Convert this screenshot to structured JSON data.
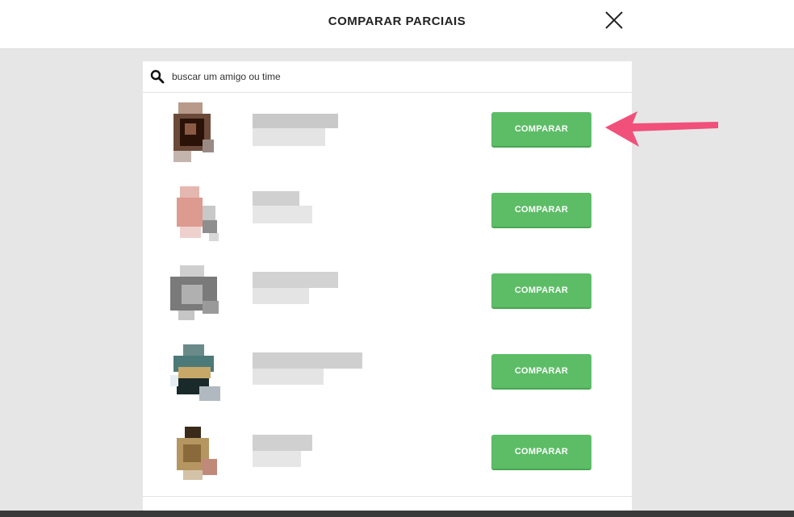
{
  "header": {
    "title": "COMPARAR PARCIAIS",
    "close_icon": "close-icon"
  },
  "search": {
    "placeholder": "buscar um amigo ou time",
    "value": "",
    "icon": "search-icon"
  },
  "friends": [
    {
      "button_label": "COMPARAR"
    },
    {
      "button_label": "COMPARAR"
    },
    {
      "button_label": "COMPARAR"
    },
    {
      "button_label": "COMPARAR"
    },
    {
      "button_label": "COMPARAR"
    }
  ],
  "annotation": {
    "icon": "arrow-left-icon",
    "color": "#f0507a"
  },
  "colors": {
    "button": "#5cbd66",
    "backdrop": "#e6e6e6",
    "panel": "#ffffff"
  }
}
